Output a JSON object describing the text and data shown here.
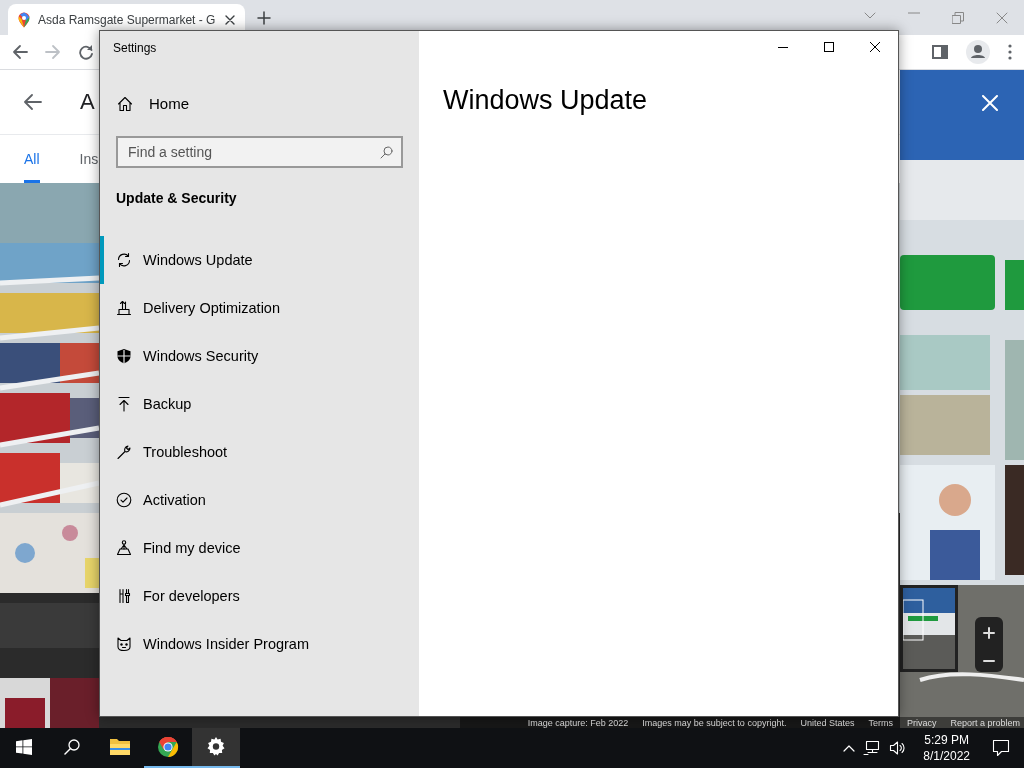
{
  "browser": {
    "tabs": [
      {
        "title": "Asda Ramsgate Supermarket - G",
        "selected": true
      }
    ],
    "maps_panel": {
      "heading": "A",
      "tabs": [
        {
          "label": "All",
          "selected": true
        },
        {
          "label": "Ins",
          "selected": false
        }
      ]
    },
    "street_view": {
      "footer": [
        "Image capture: Feb 2022",
        "Images may be subject to copyright.",
        "United States",
        "Terms",
        "Privacy",
        "Report a problem"
      ]
    }
  },
  "settings": {
    "title": "Settings",
    "home": "Home",
    "search": {
      "placeholder": "Find a setting"
    },
    "section": "Update & Security",
    "page_title": "Windows Update",
    "items": [
      {
        "label": "Windows Update",
        "selected": true
      },
      {
        "label": "Delivery Optimization",
        "selected": false
      },
      {
        "label": "Windows Security",
        "selected": false
      },
      {
        "label": "Backup",
        "selected": false
      },
      {
        "label": "Troubleshoot",
        "selected": false
      },
      {
        "label": "Activation",
        "selected": false
      },
      {
        "label": "Find my device",
        "selected": false
      },
      {
        "label": "For developers",
        "selected": false
      },
      {
        "label": "Windows Insider Program",
        "selected": false
      }
    ]
  },
  "taskbar": {
    "apps": [
      {
        "running": false,
        "selected": false
      },
      {
        "running": true,
        "selected": false
      },
      {
        "running": true,
        "selected": true
      }
    ],
    "clock": {
      "time": "5:29 PM",
      "date": "8/1/2022"
    }
  }
}
